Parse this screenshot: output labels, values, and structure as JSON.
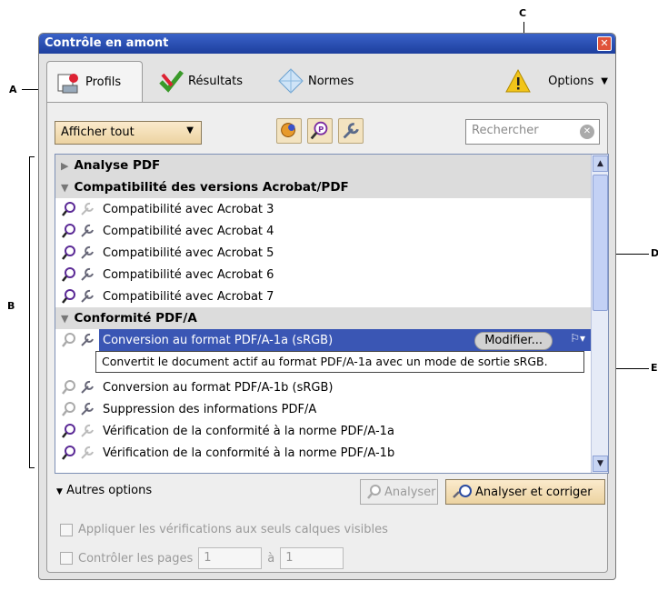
{
  "callouts": {
    "a": "A",
    "b": "B",
    "c": "C",
    "d": "D",
    "e": "E"
  },
  "window": {
    "title": "Contrôle en amont",
    "close_glyph": "✕"
  },
  "tabs": [
    {
      "label": "Profils",
      "icon": "profiles-icon"
    },
    {
      "label": "Résultats",
      "icon": "checkmark-icon"
    },
    {
      "label": "Normes",
      "icon": "diamond-icon"
    },
    {
      "label": "Options",
      "icon": "warning-icon"
    }
  ],
  "toolbar": {
    "filter_value": "Afficher tout",
    "search_placeholder": "Rechercher"
  },
  "list": {
    "sections": [
      "Analyse PDF",
      "Compatibilité des versions Acrobat/PDF",
      "Conformité PDF/A"
    ],
    "compat_items": [
      "Compatibilité avec Acrobat 3",
      "Compatibilité avec Acrobat 4",
      "Compatibilité avec Acrobat 5",
      "Compatibilité avec Acrobat 6",
      "Compatibilité avec Acrobat 7"
    ],
    "selected_item": "Conversion au format PDF/A-1a (sRGB)",
    "modify_label": "Modifier...",
    "tooltip": "Convertit le document actif au format PDF/A-1a avec un mode de sortie sRGB.",
    "pdfa_items": [
      "Conversion au format PDF/A-1b (sRGB)",
      "Suppression des informations PDF/A",
      "Vérification de la conformité à la norme PDF/A-1a",
      "Vérification de la conformité à la norme PDF/A-1b"
    ]
  },
  "bottom": {
    "more_options": "Autres options",
    "analyze": "Analyser",
    "analyze_fix": "Analyser et corriger",
    "visible_layers": "Appliquer les vérifications aux seuls calques visibles",
    "check_pages": "Contrôler les pages",
    "page_from": "1",
    "page_to_label": "à",
    "page_to": "1"
  }
}
